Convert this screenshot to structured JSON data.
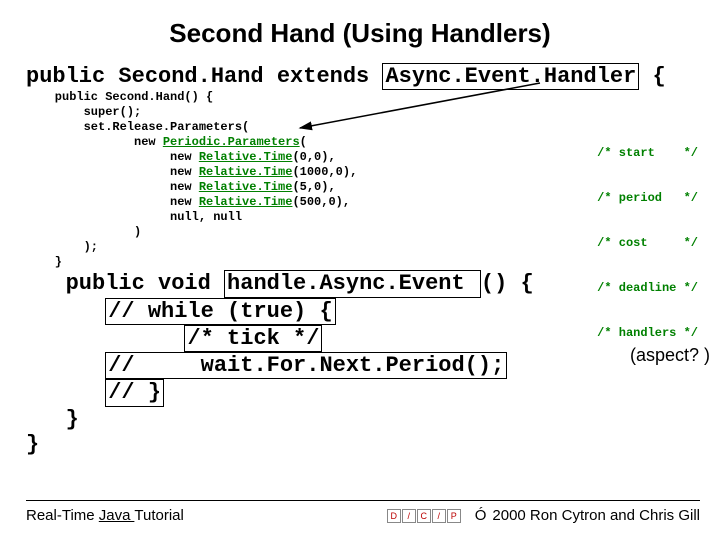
{
  "title": "Second Hand (Using Handlers)",
  "code": {
    "line1_pre": "public Second.Hand extends ",
    "line1_box": "Async.Event.Handler",
    "line1_post": " {",
    "ctor1": "    public Second.Hand() {",
    "ctor2": "        super();",
    "ctor3": "        set.Release.Parameters(",
    "ctor4_pre": "               new ",
    "ctor4_green": "Periodic.Parameters",
    "ctor4_post": "(",
    "p1_pre": "                    new ",
    "p1_green": "Relative.Time",
    "p1_post": "(0,0),",
    "p2_pre": "                    new ",
    "p2_green": "Relative.Time",
    "p2_post": "(1000,0),",
    "p3_pre": "                    new ",
    "p3_green": "Relative.Time",
    "p3_post": "(5,0),",
    "p4_pre": "                    new ",
    "p4_green": "Relative.Time",
    "p4_post": "(500,0),",
    "p5": "                    null, null",
    "ctor_close1": "               )",
    "ctor_close2": "        );",
    "ctor_close3": "    }",
    "m1_pre": "   public void ",
    "m1_box": "handle.Async.Event ",
    "m1_post": "() {",
    "m2_indent": "      ",
    "m2_box": "// while (true) {",
    "m3_indent": "            ",
    "m3_box": "/* tick */",
    "m4_indent": "      ",
    "m4_box": "//     wait.For.Next.Period();",
    "m5_indent": "      ",
    "m5_box": "// }",
    "m_close": "   }",
    "class_close": "}"
  },
  "comments": {
    "c1": "/* start    */",
    "c2": "/* period   */",
    "c3": "/* cost     */",
    "c4": "/* deadline */",
    "c5": "/* handlers */"
  },
  "aspect": "(aspect? )",
  "footer": {
    "left_pre": "Real-Time ",
    "left_ul": "Java ",
    "left_post": "Tutorial",
    "right": "2000 Ron Cytron and Chris Gill",
    "copymark": "Ó"
  }
}
